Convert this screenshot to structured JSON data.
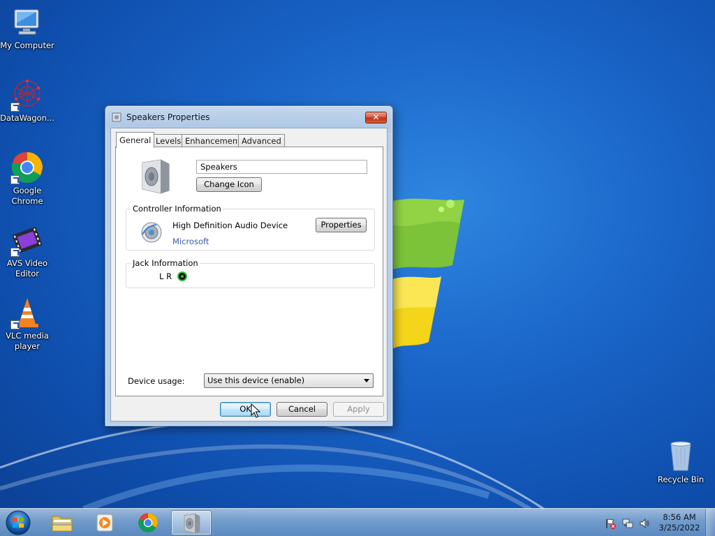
{
  "desktop": {
    "icons": [
      {
        "label": "My Computer",
        "icon": "computer-icon"
      },
      {
        "label": "DataWagon...",
        "icon": "datawagon-icon"
      },
      {
        "label": "Google Chrome",
        "icon": "chrome-icon"
      },
      {
        "label": "AVS Video Editor",
        "icon": "film-icon"
      },
      {
        "label": "VLC media player",
        "icon": "vlc-cone-icon"
      },
      {
        "label": "Recycle Bin",
        "icon": "recycle-bin-icon"
      }
    ]
  },
  "dialog": {
    "title": "Speakers Properties",
    "close_label": "✕",
    "tabs": [
      "General",
      "Levels",
      "Enhancements",
      "Advanced"
    ],
    "active_tab": "General",
    "general": {
      "device_name": "Speakers",
      "change_icon_label": "Change Icon",
      "controller": {
        "group_label": "Controller Information",
        "device": "High Definition Audio Device",
        "vendor": "Microsoft",
        "properties_label": "Properties"
      },
      "jack": {
        "group_label": "Jack Information",
        "channels": "L R",
        "color": "#2fbf3a"
      },
      "usage_label": "Device usage:",
      "usage_value": "Use this device (enable)"
    },
    "buttons": {
      "ok": "OK",
      "cancel": "Cancel",
      "apply": "Apply"
    }
  },
  "taskbar": {
    "pinned": [
      "explorer-icon",
      "media-player-icon",
      "chrome-icon",
      "speaker-icon"
    ],
    "active": "speaker-icon",
    "tray": [
      "action-center-flag-icon",
      "network-icon",
      "volume-icon"
    ],
    "time": "8:56 AM",
    "date": "3/25/2022"
  }
}
